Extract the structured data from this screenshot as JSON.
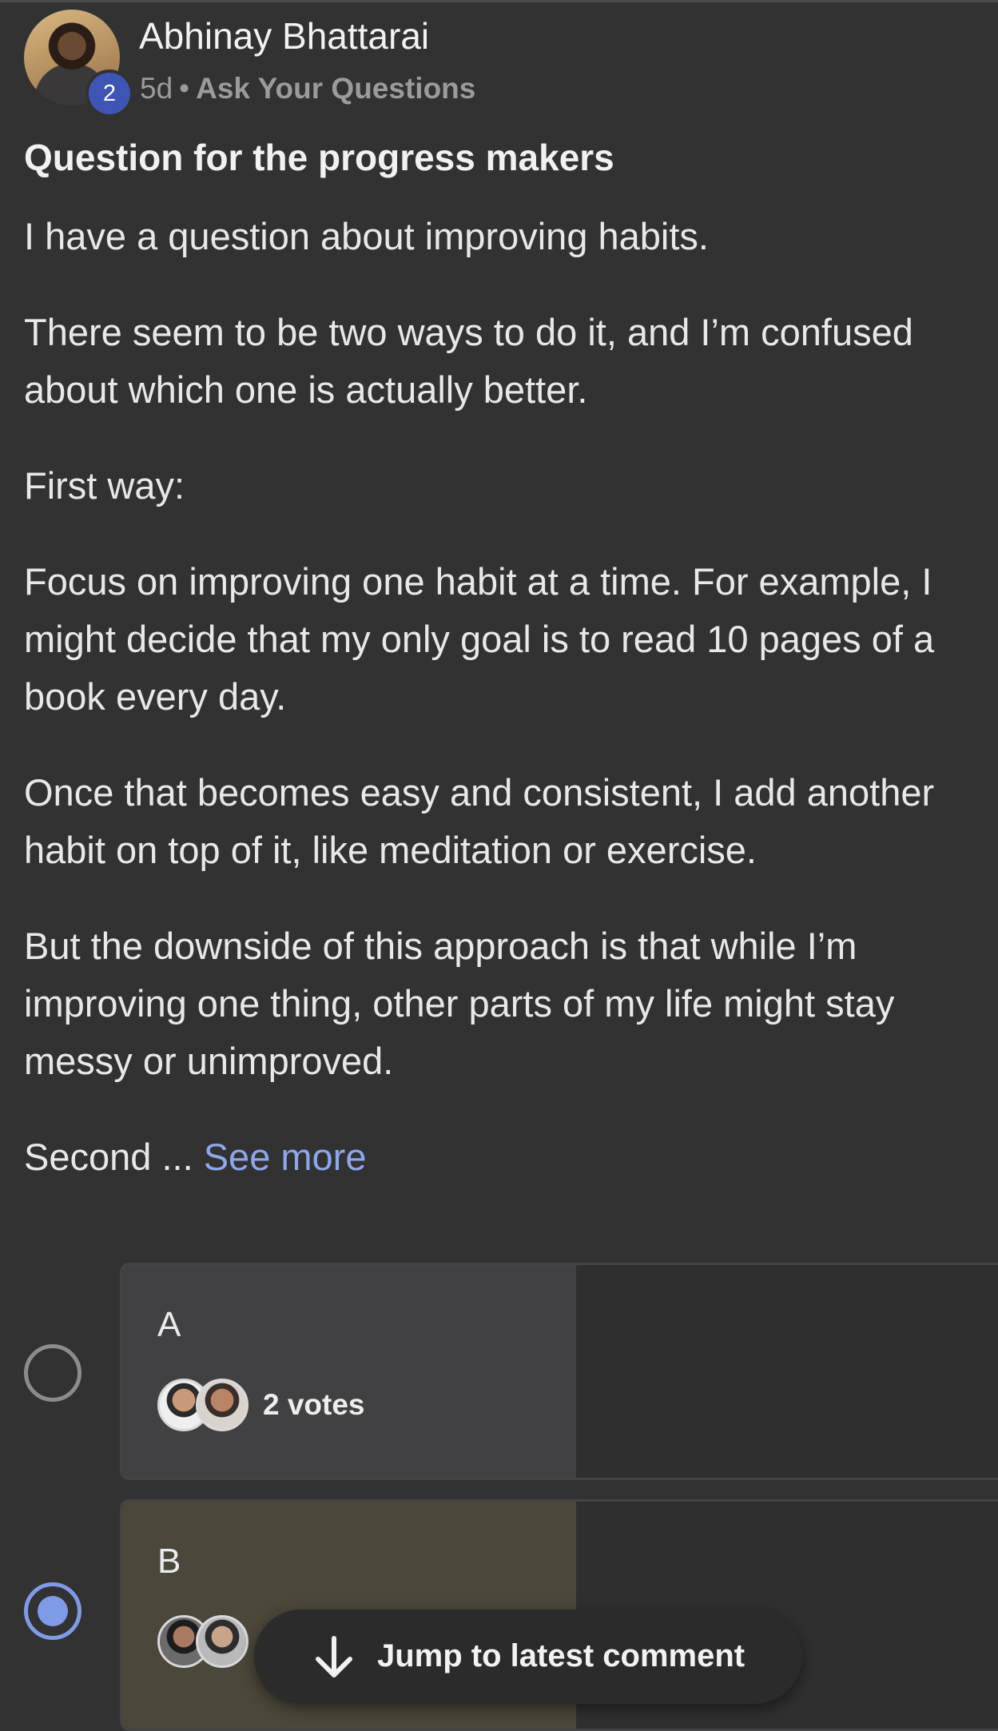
{
  "post": {
    "author": "Abhinay Bhattarai",
    "level_badge": "2",
    "age": "5d",
    "separator": "•",
    "group": "Ask Your Questions",
    "title": "Question for the progress makers",
    "paragraphs": [
      "I have a question about improving habits.",
      "There seem to be two ways to do it, and I’m confused about which one is actually better.",
      "First way:",
      "Focus on improving one habit at a time. For example, I might decide that my only goal is to read 10 pages of a book every day.",
      "Once that becomes easy and consistent, I add another habit on top of it, like meditation or exercise.",
      "But the downside of this approach is that while I’m improving one thing, other parts of my life might stay messy or unimproved."
    ],
    "truncated_text": "Second ... ",
    "see_more": "See more"
  },
  "poll": {
    "options": [
      {
        "label": "A",
        "votes_text": "2 votes",
        "selected": false
      },
      {
        "label": "B",
        "votes_text": "",
        "selected": true
      }
    ]
  },
  "jump_button": {
    "label": "Jump to latest comment"
  },
  "colors": {
    "background": "#323233",
    "accent": "#7f9be8",
    "badge": "#3f55b5",
    "option_a_fill": "#414143",
    "option_b_fill": "#4b473a"
  }
}
